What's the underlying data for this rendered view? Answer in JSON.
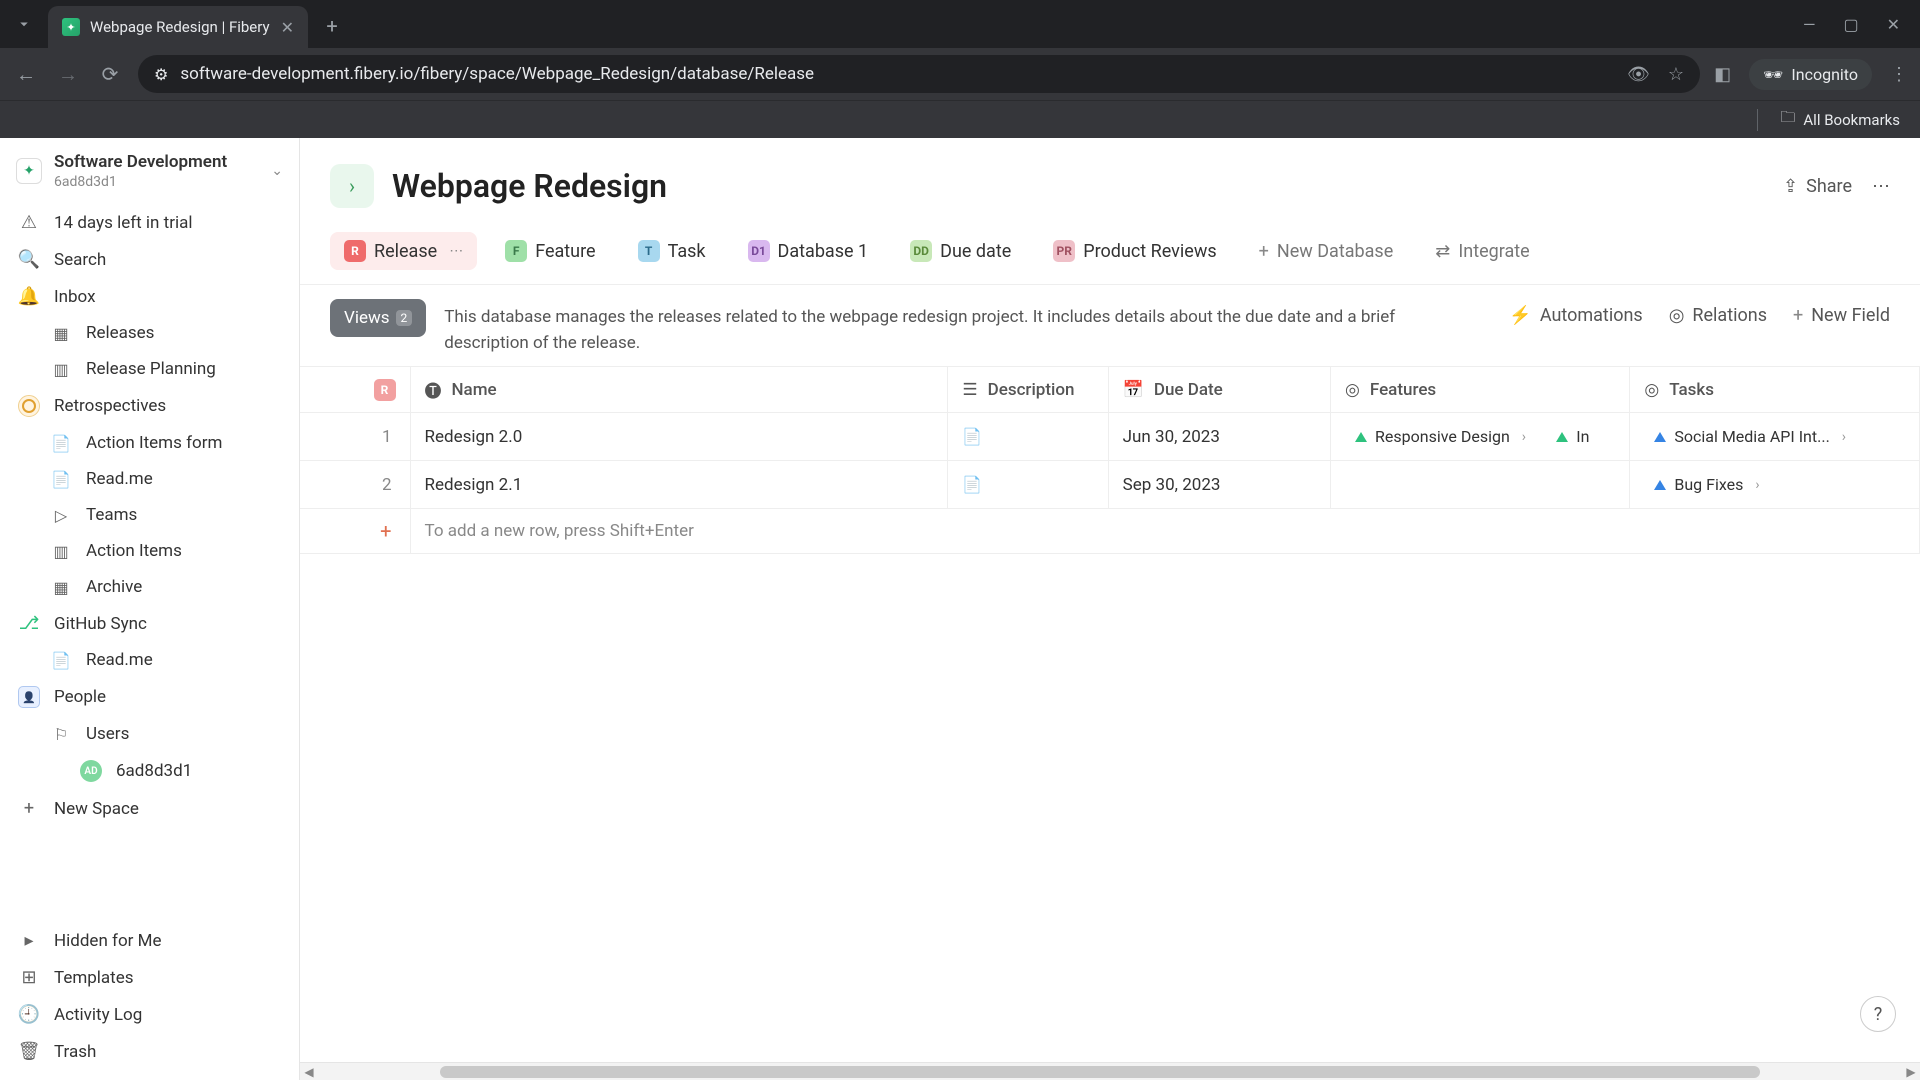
{
  "browser": {
    "tab_title": "Webpage Redesign | Fibery",
    "url": "software-development.fibery.io/fibery/space/Webpage_Redesign/database/Release",
    "incognito_label": "Incognito",
    "all_bookmarks": "All Bookmarks"
  },
  "workspace": {
    "name": "Software Development",
    "subid": "6ad8d3d1"
  },
  "sidebar": {
    "trial": "14 days left in trial",
    "search": "Search",
    "inbox": "Inbox",
    "releases": "Releases",
    "release_planning": "Release Planning",
    "retrospectives": "Retrospectives",
    "action_items_form": "Action Items form",
    "readme1": "Read.me",
    "teams": "Teams",
    "action_items": "Action Items",
    "archive": "Archive",
    "github_sync": "GitHub Sync",
    "readme2": "Read.me",
    "people": "People",
    "users": "Users",
    "user_id": "6ad8d3d1",
    "new_space": "New Space",
    "hidden": "Hidden for Me",
    "templates": "Templates",
    "activity": "Activity Log",
    "trash": "Trash"
  },
  "page": {
    "title": "Webpage Redesign",
    "share": "Share",
    "tabs": {
      "release": "Release",
      "feature": "Feature",
      "task": "Task",
      "database1": "Database 1",
      "due_date": "Due date",
      "product_reviews": "Product Reviews",
      "new_database": "New Database",
      "integrate": "Integrate"
    },
    "views_label": "Views",
    "views_count": "2",
    "description": "This database manages the releases related to the webpage redesign project. It includes details about the due date and a brief description of the release.",
    "automations": "Automations",
    "relations": "Relations",
    "new_field": "New Field"
  },
  "table": {
    "columns": {
      "name": "Name",
      "description": "Description",
      "due_date": "Due Date",
      "features": "Features",
      "tasks": "Tasks"
    },
    "rows": [
      {
        "num": "1",
        "name": "Redesign 2.0",
        "due": "Jun 30, 2023",
        "features": [
          "Responsive Design",
          "In"
        ],
        "tasks": [
          "Social Media API Int..."
        ]
      },
      {
        "num": "2",
        "name": "Redesign 2.1",
        "due": "Sep 30, 2023",
        "features": [],
        "tasks": [
          "Bug Fixes"
        ]
      }
    ],
    "add_row_hint": "To add a new row, press Shift+Enter"
  },
  "badges": {
    "release": {
      "text": "R",
      "bg": "#ef6b6b"
    },
    "feature": {
      "text": "F",
      "bg": "#9fe0a8"
    },
    "task": {
      "text": "T",
      "bg": "#a8d8ef"
    },
    "database1": {
      "text": "D1",
      "bg": "#d9b8ef"
    },
    "due_date": {
      "text": "DD",
      "bg": "#c8e8b8"
    },
    "product_reviews": {
      "text": "PR",
      "bg": "#efc0c8"
    }
  }
}
